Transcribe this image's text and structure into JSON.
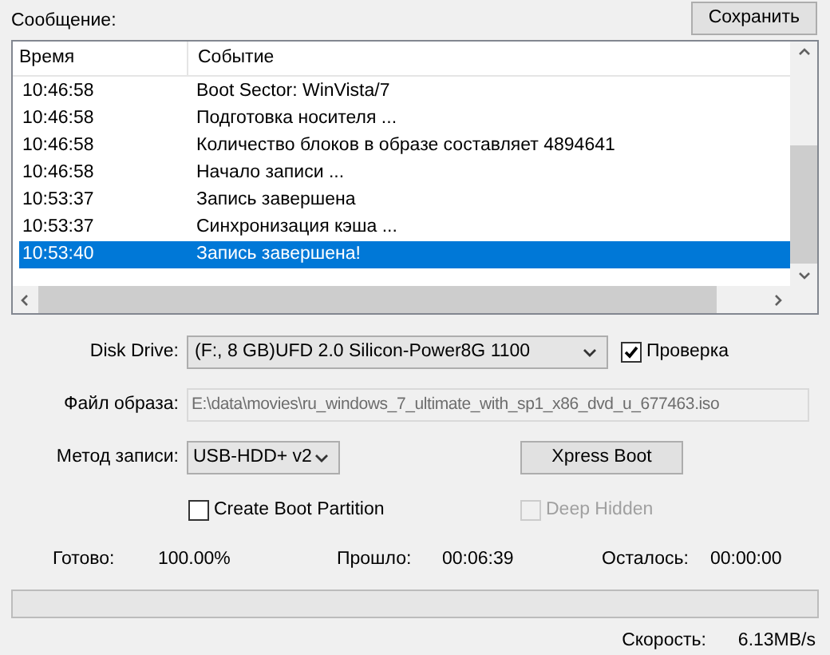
{
  "message_label": "Сообщение:",
  "save_button": "Сохранить",
  "log": {
    "columns": [
      "Время",
      "Событие"
    ],
    "rows": [
      {
        "time": "10:46:58",
        "event": "Boot Sector: WinVista/7",
        "selected": false
      },
      {
        "time": "10:46:58",
        "event": "Подготовка носителя ...",
        "selected": false
      },
      {
        "time": "10:46:58",
        "event": "Количество блоков в образе составляет 4894641",
        "selected": false
      },
      {
        "time": "10:46:58",
        "event": "Начало записи ...",
        "selected": false
      },
      {
        "time": "10:53:37",
        "event": "Запись завершена",
        "selected": false
      },
      {
        "time": "10:53:37",
        "event": "Синхронизация кэша ...",
        "selected": false
      },
      {
        "time": "10:53:40",
        "event": "Запись завершена!",
        "selected": true
      }
    ]
  },
  "disk_drive": {
    "label": "Disk Drive:",
    "value": "(F:, 8 GB)UFD 2.0 Silicon-Power8G 1100"
  },
  "verify": {
    "label": "Проверка",
    "checked": true,
    "disabled": false
  },
  "image_file": {
    "label": "Файл образа:",
    "value": "E:\\data\\movies\\ru_windows_7_ultimate_with_sp1_x86_dvd_u_677463.iso"
  },
  "write_method": {
    "label": "Метод записи:",
    "value": "USB-HDD+ v2"
  },
  "xpress_boot_button": "Xpress Boot",
  "create_boot_partition": {
    "label": "Create Boot Partition",
    "checked": false,
    "disabled": false
  },
  "deep_hidden": {
    "label": "Deep Hidden",
    "checked": false,
    "disabled": true
  },
  "stats": [
    {
      "label": "Готово:",
      "value": "100.00%"
    },
    {
      "label": "Прошло:",
      "value": "00:06:39"
    },
    {
      "label": "Осталось:",
      "value": "00:00:00"
    }
  ],
  "progress": {
    "level": 0
  },
  "speed": {
    "label": "Скорость:",
    "value": "6.13MB/s"
  }
}
